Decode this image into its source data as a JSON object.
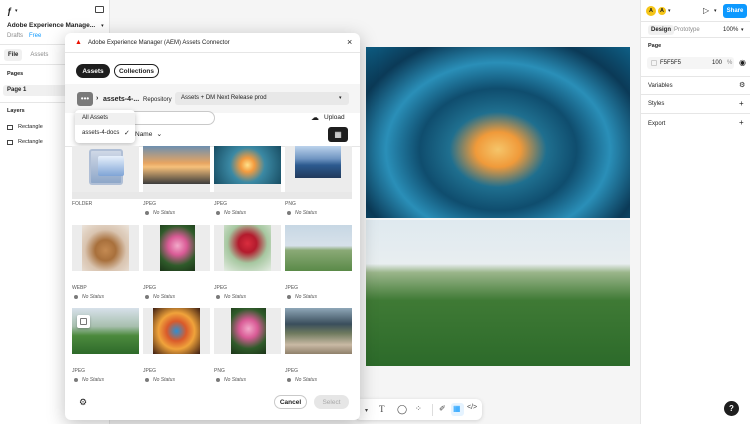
{
  "left_panel": {
    "file_name": "Adobe Experience Manage...",
    "location": "Drafts",
    "plan_badge": "Free",
    "tabs": [
      "File",
      "Assets"
    ],
    "pages_title": "Pages",
    "pages": [
      "Page 1"
    ],
    "layers_title": "Layers",
    "layers": [
      "Rectangle",
      "Rectangle"
    ]
  },
  "right_panel": {
    "avatars": [
      "A",
      "A"
    ],
    "share_label": "Share",
    "tabs": [
      "Design",
      "Prototype"
    ],
    "zoom": "100%",
    "page_section": "Page",
    "page_color": "F5F5F5",
    "page_opacity": "100",
    "opacity_unit": "%",
    "variables": "Variables",
    "styles": "Styles",
    "export": "Export"
  },
  "modal": {
    "title": "Adobe Experience Manager (AEM) Assets Connector",
    "tabs": [
      "Assets",
      "Collections"
    ],
    "breadcrumb": "assets-4-...",
    "repository_label": "Repository",
    "repository_value": "Assets + DM Next Release prod",
    "upload_label": "Upload",
    "sort_label": "Name",
    "dropdown_items": [
      "All Assets",
      "assets-4-docs"
    ],
    "cancel_label": "Cancel",
    "select_label": "Select",
    "assets": [
      {
        "type": "FOLDER",
        "status": ""
      },
      {
        "type": "JPEG",
        "status": "No Status"
      },
      {
        "type": "JPEG",
        "status": "No Status"
      },
      {
        "type": "PNG",
        "status": "No Status"
      },
      {
        "type": "WEBP",
        "status": "No Status"
      },
      {
        "type": "JPEG",
        "status": "No Status"
      },
      {
        "type": "JPEG",
        "status": "No Status"
      },
      {
        "type": "JPEG",
        "status": "No Status"
      },
      {
        "type": "JPEG",
        "status": "No Status"
      },
      {
        "type": "JPEG",
        "status": "No Status"
      },
      {
        "type": "PNG",
        "status": "No Status"
      },
      {
        "type": "JPEG",
        "status": "No Status"
      }
    ]
  },
  "colors": {
    "accent": "#0d99ff",
    "brand_red": "#eb1000",
    "avatar_yellow": "#f5c518"
  }
}
